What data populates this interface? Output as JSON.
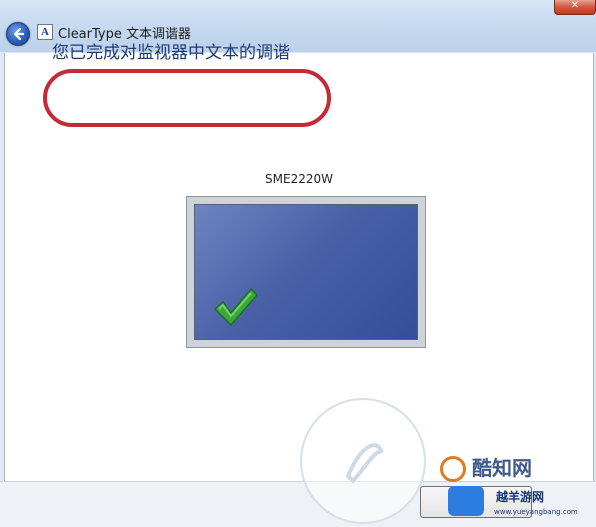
{
  "window": {
    "title": "ClearType 文本调谐器",
    "close_label": "✕"
  },
  "main": {
    "heading": "您已完成对监视器中文本的调谐",
    "monitor_name": "SME2220W"
  },
  "footer": {
    "finish_label": ""
  },
  "watermark": {
    "line1": "酷知网",
    "line2": "越羊游网",
    "line3": "www.yueyangbang.com"
  },
  "colors": {
    "heading": "#1e3a78",
    "highlight_ring": "#c52b36",
    "check": "#3aa83a"
  }
}
